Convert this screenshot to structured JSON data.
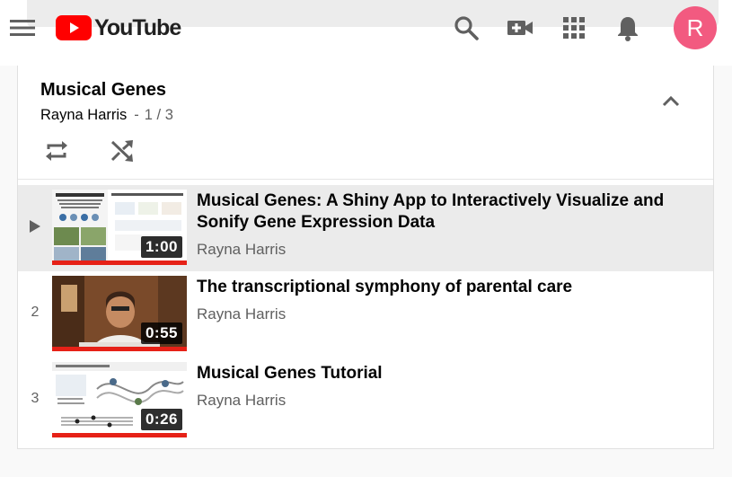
{
  "header": {
    "logo_text": "YouTube",
    "brand_color": "#ff0000",
    "avatar_letter": "R",
    "avatar_color": "#f25a80",
    "icons": [
      "menu-icon",
      "search-icon",
      "video-camera-icon",
      "apps-icon",
      "notifications-icon"
    ]
  },
  "playlist": {
    "title": "Musical Genes",
    "owner": "Rayna Harris",
    "separator": "-",
    "position": "1 / 3",
    "controls": [
      "loop-icon",
      "shuffle-icon",
      "collapse-icon"
    ],
    "items": [
      {
        "index": "▶",
        "title": "Musical Genes: A Shiny App to Interactively Visualize and Sonify Gene Expression Data",
        "channel": "Rayna Harris",
        "duration": "1:00",
        "active": true,
        "thumbnail_icon": "slides-thumbnail"
      },
      {
        "index": "2",
        "title": "The transcriptional symphony of parental care",
        "channel": "Rayna Harris",
        "duration": "0:55",
        "active": false,
        "thumbnail_icon": "presenter-thumbnail"
      },
      {
        "index": "3",
        "title": "Musical Genes Tutorial",
        "channel": "Rayna Harris",
        "duration": "0:26",
        "active": false,
        "thumbnail_icon": "tutorial-thumbnail"
      }
    ]
  }
}
